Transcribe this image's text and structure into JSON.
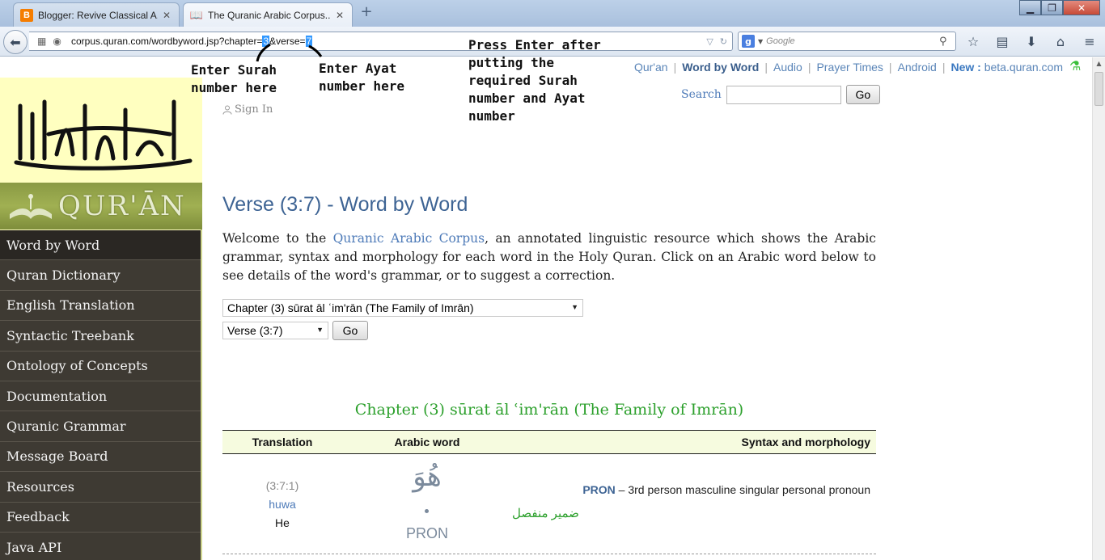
{
  "browser": {
    "tabs": [
      {
        "label": "Blogger: Revive Classical A...",
        "active": false,
        "icon": "blogger-icon"
      },
      {
        "label": "The Quranic Arabic Corpus...",
        "active": true,
        "icon": "book-icon"
      }
    ],
    "url": {
      "prefix": "corpus.quran.com/wordbyword.jsp?chapter=",
      "chapter": "3",
      "mid": "&verse=",
      "verse": "7"
    },
    "search_placeholder": "Google",
    "search_engine_letter": "g"
  },
  "page": {
    "top_links": {
      "quran": "Qur'an",
      "word_by_word": "Word by Word",
      "audio": "Audio",
      "prayer_times": "Prayer Times",
      "android": "Android",
      "new_label": "New :",
      "beta": "beta.quran.com"
    },
    "logo_text": "QUR'ĀN",
    "sign_in": "Sign In",
    "search_label": "Search",
    "search_go": "Go",
    "menu": [
      "Word by Word",
      "Quran Dictionary",
      "English Translation",
      "Syntactic Treebank",
      "Ontology of Concepts",
      "Documentation",
      "Quranic Grammar",
      "Message Board",
      "Resources",
      "Feedback",
      "Java API"
    ],
    "heading": "Verse (3:7) - Word by Word",
    "intro_before": "Welcome to the ",
    "intro_link": "Quranic Arabic Corpus",
    "intro_after": ", an annotated linguistic resource which shows the Arabic grammar, syntax and morphology for each word in the Holy Quran. Click on an Arabic word below to see details of the word's grammar, or to suggest a correction.",
    "chapter_select": "Chapter (3) sūrat āl ʿim'rān (The Family of Imrān)",
    "verse_select": "Verse (3:7)",
    "verse_go": "Go",
    "chapter_heading": "Chapter (3) sūrat āl ʿim'rān (The Family of Imrān)",
    "table": {
      "headers": [
        "Translation",
        "Arabic word",
        "Syntax and morphology"
      ],
      "rows": [
        {
          "location": "(3:7:1)",
          "transliteration": "huwa",
          "gloss": "He",
          "arabic": "هُوَ",
          "tag": "PRON",
          "pos": "PRON",
          "description": " – 3rd person masculine singular personal pronoun",
          "arabic_description": "ضمير منفصل"
        }
      ]
    }
  },
  "annotations": {
    "surah": "Enter Surah\nnumber here",
    "ayat": "Enter Ayat\nnumber here",
    "enter": "Press Enter after\nputting the\nrequired Surah\nnumber and Ayat\nnumber"
  }
}
